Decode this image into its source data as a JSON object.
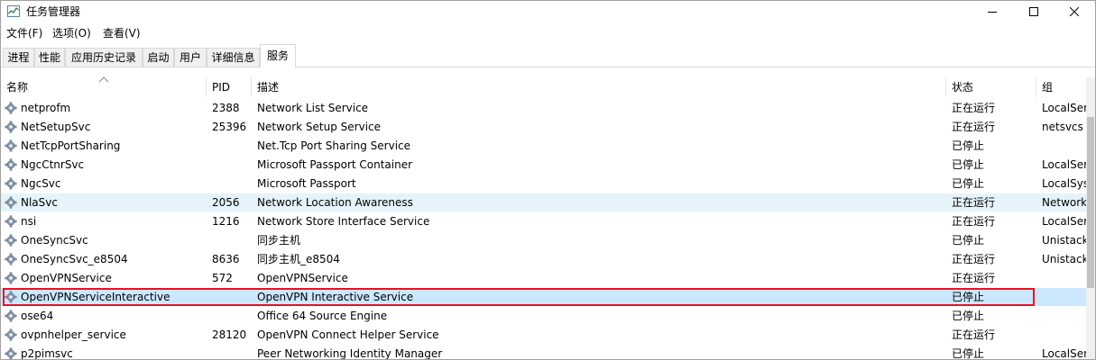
{
  "window": {
    "title": "任务管理器"
  },
  "menu": [
    {
      "label": "文件(F)"
    },
    {
      "label": "选项(O)"
    },
    {
      "label": "查看(V)"
    }
  ],
  "tabs": [
    {
      "label": "进程",
      "active": false
    },
    {
      "label": "性能",
      "active": false
    },
    {
      "label": "应用历史记录",
      "active": false
    },
    {
      "label": "启动",
      "active": false
    },
    {
      "label": "用户",
      "active": false
    },
    {
      "label": "详细信息",
      "active": false
    },
    {
      "label": "服务",
      "active": true
    }
  ],
  "table": {
    "columns": {
      "name": "名称",
      "pid": "PID",
      "desc": "描述",
      "status": "状态",
      "group": "组"
    },
    "sort_column": "name",
    "rows": [
      {
        "name": "netprofm",
        "pid": "2388",
        "desc": "Network List Service",
        "status": "正在运行",
        "group": "LocalService"
      },
      {
        "name": "NetSetupSvc",
        "pid": "25396",
        "desc": "Network Setup Service",
        "status": "正在运行",
        "group": "netsvcs"
      },
      {
        "name": "NetTcpPortSharing",
        "pid": "",
        "desc": "Net.Tcp Port Sharing Service",
        "status": "已停止",
        "group": ""
      },
      {
        "name": "NgcCtnrSvc",
        "pid": "",
        "desc": "Microsoft Passport Container",
        "status": "已停止",
        "group": "LocalService"
      },
      {
        "name": "NgcSvc",
        "pid": "",
        "desc": "Microsoft Passport",
        "status": "已停止",
        "group": "LocalSystem"
      },
      {
        "name": "NlaSvc",
        "pid": "2056",
        "desc": "Network Location Awareness",
        "status": "正在运行",
        "group": "NetworkService"
      },
      {
        "name": "nsi",
        "pid": "1216",
        "desc": "Network Store Interface Service",
        "status": "正在运行",
        "group": "LocalService"
      },
      {
        "name": "OneSyncSvc",
        "pid": "",
        "desc": "同步主机",
        "status": "已停止",
        "group": "UnistackSvcGroup"
      },
      {
        "name": "OneSyncSvc_e8504",
        "pid": "8636",
        "desc": "同步主机_e8504",
        "status": "正在运行",
        "group": "UnistackSvcGroup"
      },
      {
        "name": "OpenVPNService",
        "pid": "572",
        "desc": "OpenVPNService",
        "status": "正在运行",
        "group": ""
      },
      {
        "name": "OpenVPNServiceInteractive",
        "pid": "",
        "desc": "OpenVPN Interactive Service",
        "status": "已停止",
        "group": ""
      },
      {
        "name": "ose64",
        "pid": "",
        "desc": "Office 64 Source Engine",
        "status": "已停止",
        "group": ""
      },
      {
        "name": "ovpnhelper_service",
        "pid": "28120",
        "desc": "OpenVPN Connect Helper Service",
        "status": "正在运行",
        "group": ""
      },
      {
        "name": "p2pimsvc",
        "pid": "",
        "desc": "Peer Networking Identity Manager",
        "status": "已停止",
        "group": "LocalService"
      }
    ],
    "hovered_row": 5,
    "selected_row": 10
  },
  "colors": {
    "hover_row": "#e5f3fb",
    "selected_row": "#cce8ff",
    "focus_border": "#e81123"
  }
}
